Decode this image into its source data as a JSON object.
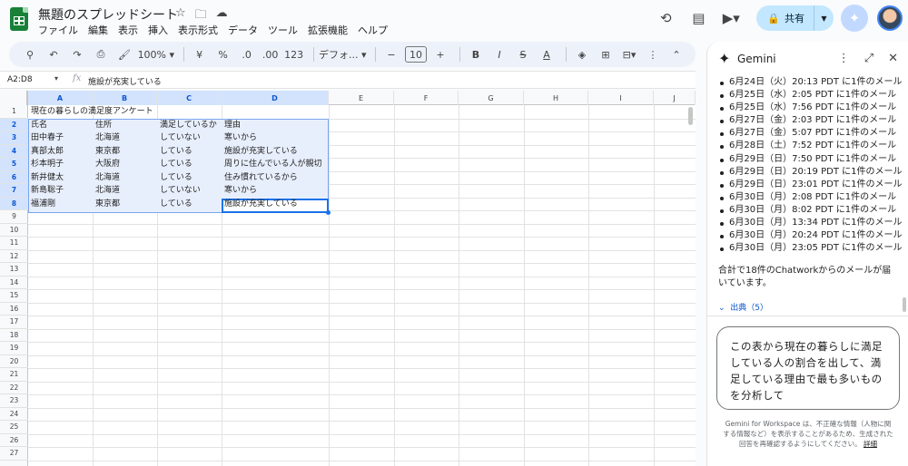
{
  "document": {
    "title": "無題のスプレッドシート"
  },
  "menu": [
    "ファイル",
    "編集",
    "表示",
    "挿入",
    "表示形式",
    "データ",
    "ツール",
    "拡張機能",
    "ヘルプ"
  ],
  "share": {
    "label": "共有"
  },
  "toolbar": {
    "zoom": "100%",
    "currency": "¥",
    "percent": "%",
    "decrease_decimals": ".0",
    "increase_decimals": ".00",
    "number_format": "123",
    "font": "デフォ...",
    "minus": "−",
    "font_size": "10",
    "plus": "+",
    "bold": "B",
    "italic": "I",
    "strike": "S",
    "text_color": "A"
  },
  "formula_bar": {
    "range": "A2:D8",
    "fx": "fx",
    "value": "施設が充実している"
  },
  "grid": {
    "columns": [
      "A",
      "B",
      "C",
      "D",
      "E",
      "F",
      "G",
      "H",
      "I",
      "J"
    ],
    "rows": [
      "1",
      "2",
      "3",
      "4",
      "5",
      "6",
      "7",
      "8",
      "9",
      "10",
      "11",
      "12",
      "13",
      "14",
      "15",
      "16",
      "17",
      "18",
      "19",
      "20",
      "21",
      "22",
      "23",
      "24",
      "25",
      "26",
      "27"
    ],
    "title": "現在の暮らしの満足度アンケート",
    "header": [
      "氏名",
      "住所",
      "満足しているか",
      "理由"
    ],
    "data": [
      [
        "田中春子",
        "北海道",
        "していない",
        "寒いから"
      ],
      [
        "真部太郎",
        "東京都",
        "している",
        "施設が充実している"
      ],
      [
        "杉本明子",
        "大阪府",
        "している",
        "周りに住んでいる人が親切"
      ],
      [
        "新井健太",
        "北海道",
        "している",
        "住み慣れているから"
      ],
      [
        "新島聡子",
        "北海道",
        "していない",
        "寒いから"
      ],
      [
        "福浦剛",
        "東京都",
        "している",
        "施設が充実している"
      ]
    ]
  },
  "gemini": {
    "title": "Gemini",
    "list": [
      "6月24日（火）20:13 PDT に1件のメール",
      "6月25日（水）2:05 PDT に1件のメール",
      "6月25日（水）7:56 PDT に1件のメール",
      "6月27日（金）2:03 PDT に1件のメール",
      "6月27日（金）5:07 PDT に1件のメール",
      "6月28日（土）7:52 PDT に1件のメール",
      "6月29日（日）7:50 PDT に1件のメール",
      "6月29日（日）20:19 PDT に1件のメール",
      "6月29日（日）23:01 PDT に1件のメール",
      "6月30日（月）2:08 PDT に1件のメール",
      "6月30日（月）8:02 PDT に1件のメール",
      "6月30日（月）13:34 PDT に1件のメール",
      "6月30日（月）20:24 PDT に1件のメール",
      "6月30日（月）23:05 PDT に1件のメール"
    ],
    "summary": "合計で18件のChatworkからのメールが届いています。",
    "sources": "出典（5）",
    "prompt": "この表から現在の暮らしに満足している人の割合を出して、満足している理由で最も多いものを分析して",
    "disclaimer": "Gemini for Workspace は、不正確な情報（人物に関する情報など）を表示することがあるため、生成された回答を再確認するようにしてください。",
    "details": "詳細"
  },
  "colors": {
    "accent": "#1a73e8",
    "selection": "#d3e3fd",
    "share_bg": "#c2e7ff",
    "sheets_green": "#188038"
  }
}
